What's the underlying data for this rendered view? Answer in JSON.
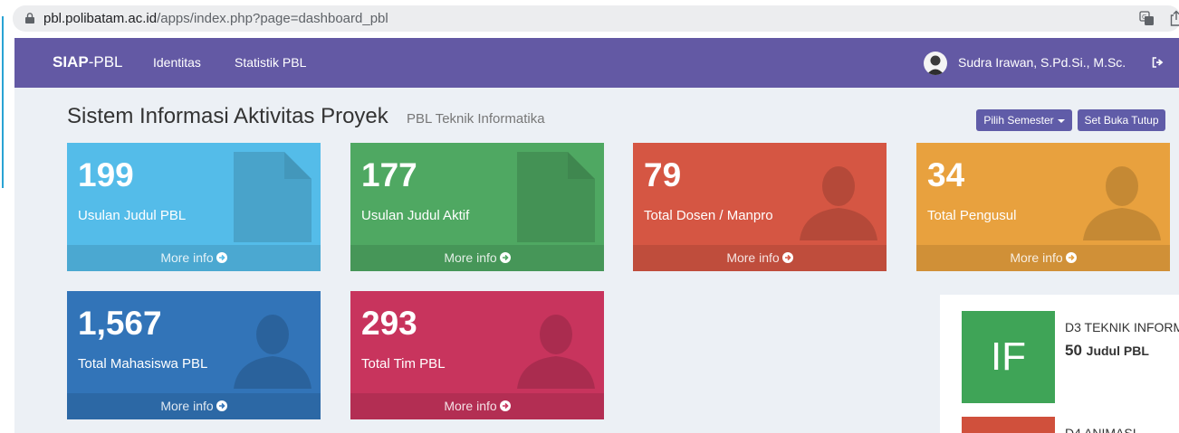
{
  "browser": {
    "url_host": "pbl.polibatam.ac.id",
    "url_path": "/apps/index.php?page=dashboard_pbl"
  },
  "navbar": {
    "brand_bold": "SIAP",
    "brand_rest": "-PBL",
    "links": [
      "Identitas",
      "Statistik PBL"
    ],
    "user_name": "Sudra Irawan, S.Pd.Si., M.Sc.",
    "color": "#6359a4"
  },
  "header": {
    "title": "Sistem Informasi Aktivitas Proyek",
    "subtitle": "PBL Teknik Informatika",
    "semester_button": "Pilih Semester",
    "open_close_button": "Set Buka Tutup",
    "button_color": "#605ca8"
  },
  "stats": [
    {
      "value": "199",
      "label": "Usulan Judul PBL",
      "footer": "More info",
      "color": "#54bce9",
      "icon": "document-icon"
    },
    {
      "value": "177",
      "label": "Usulan Judul Aktif",
      "footer": "More info",
      "color": "#4fa862",
      "icon": "document-icon"
    },
    {
      "value": "79",
      "label": "Total Dosen / Manpro",
      "footer": "More info",
      "color": "#d55643",
      "icon": "user-icon"
    },
    {
      "value": "34",
      "label": "Total Pengusul",
      "footer": "More info",
      "color": "#e8a13e",
      "icon": "user-icon"
    },
    {
      "value": "1,567",
      "label": "Total Mahasiswa PBL",
      "footer": "More info",
      "color": "#3274b8",
      "icon": "user-icon"
    },
    {
      "value": "293",
      "label": "Total Tim PBL",
      "footer": "More info",
      "color": "#c8345d",
      "icon": "user-icon"
    }
  ],
  "programs": [
    {
      "code": "IF",
      "name": "D3 TEKNIK INFORM",
      "count": "50",
      "unit": "Judul PBL",
      "color": "#3fa457"
    },
    {
      "name": "D4 ANIMASI",
      "color": "#d0503c"
    }
  ]
}
